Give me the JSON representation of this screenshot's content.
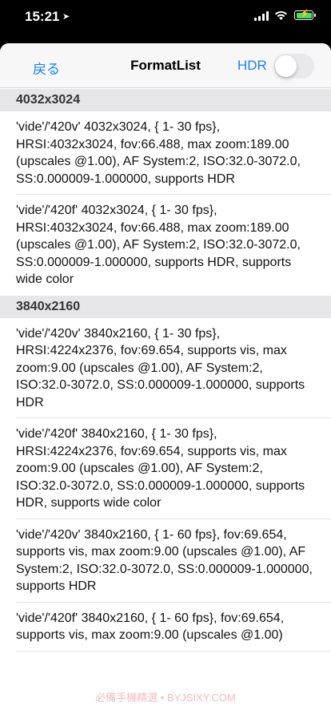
{
  "status_bar": {
    "time": "15:21"
  },
  "nav": {
    "back_label": "戻る",
    "title": "FormatList",
    "hdr_label": "HDR",
    "hdr_enabled": false
  },
  "sections": [
    {
      "title": "4032x3024",
      "rows": [
        "'vide'/'420v' 4032x3024, { 1- 30 fps}, HRSI:4032x3024, fov:66.488, max zoom:189.00 (upscales @1.00), AF System:2, ISO:32.0-3072.0, SS:0.000009-1.000000, supports HDR",
        "'vide'/'420f' 4032x3024, { 1- 30 fps}, HRSI:4032x3024, fov:66.488, max zoom:189.00 (upscales @1.00), AF System:2, ISO:32.0-3072.0, SS:0.000009-1.000000, supports HDR, supports wide color"
      ]
    },
    {
      "title": "3840x2160",
      "rows": [
        "'vide'/'420v' 3840x2160, { 1- 30 fps}, HRSI:4224x2376, fov:69.654, supports vis, max zoom:9.00 (upscales @1.00), AF System:2, ISO:32.0-3072.0, SS:0.000009-1.000000, supports HDR",
        "'vide'/'420f' 3840x2160, { 1- 30 fps}, HRSI:4224x2376, fov:69.654, supports vis, max zoom:9.00 (upscales @1.00), AF System:2, ISO:32.0-3072.0, SS:0.000009-1.000000, supports HDR, supports wide color",
        "'vide'/'420v' 3840x2160, { 1- 60 fps}, fov:69.654, supports vis, max zoom:9.00 (upscales @1.00), AF System:2, ISO:32.0-3072.0, SS:0.000009-1.000000, supports HDR",
        "'vide'/'420f' 3840x2160, { 1- 60 fps}, fov:69.654, supports vis, max zoom:9.00 (upscales @1.00)"
      ]
    }
  ],
  "watermark": "必備手機精選 • BYJSIXY.COM"
}
